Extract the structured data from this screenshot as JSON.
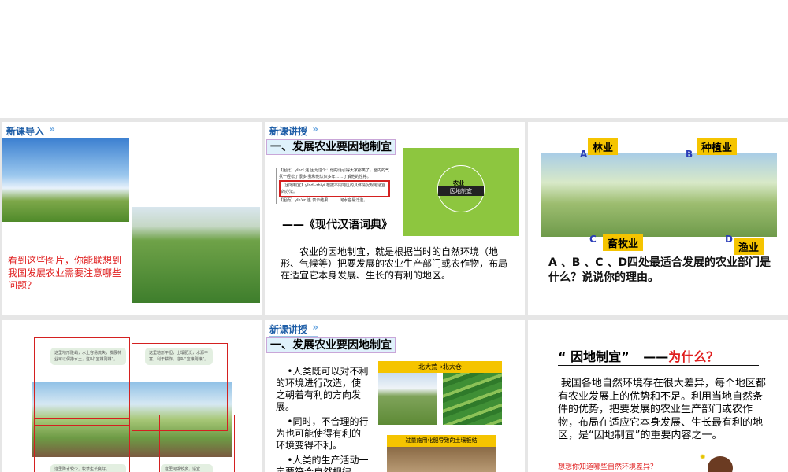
{
  "slide1": {
    "header": "新课导入",
    "question": "看到这些图片，你能联想到我国发展农业需要注意哪些问题？"
  },
  "slide2": {
    "header": "新课讲授",
    "section": "一、发展农业要因地制宜",
    "dict_entries": [
      "【因此】yīncǐ 连 因为这个：他的话引得大家都笑了，室内的气氛一经松了很多|我和他认识多年……了解他的性格。",
      "【因地制宜】yīndì-zhìyí 根据不同地区的具体情况规定适宜的办法。",
      "【因而】yīn'ér 连 表示结果：……河水容易泛滥。"
    ],
    "source": "——《现代汉语词典》",
    "diagram_center": "因地制宜",
    "diagram_top": "农业",
    "bullet": "农业的因地制宜，就是根据当时的自然环境（地形、气候等）把要发展的农业生产部门或农作物，布局在适宜它本身发展、生长的有利的地区。"
  },
  "slide3": {
    "labels": {
      "forestry": "林业",
      "planting": "种植业",
      "husbandry": "畜牧业",
      "fishery": "渔业"
    },
    "letters": {
      "a": "A",
      "b": "B",
      "c": "C",
      "d": "D"
    },
    "question": "A 、B 、C 、D四处最适合发展的农业部门是什么？说说你的理由。"
  },
  "slide4": {
    "bubbles": [
      "这里地形陡峭，水土容易流失，发展林业可以保持水土，这叫“宜林则林”。",
      "这里地形平坦，土壤肥沃，水源丰富，利于耕作，这叫“宜粮则粮”。",
      "这里降水较少，牧草生长良好，",
      "这里河湖较多，适宜"
    ]
  },
  "slide5": {
    "header": "新课讲授",
    "section": "一、发展农业要因地制宜",
    "points": [
      "•人类既可以对不利的环境进行改造，使之朝着有利的方向发展。",
      "•同时，不合理的行为也可能使得有利的环境变得不利。",
      "•人类的生产活动一定要符合自然规律，这样才可能持续"
    ],
    "photo1_caption": "北大荒→北大仓",
    "photo2_caption": "过量施用化肥导致的土壤板结"
  },
  "slide6": {
    "title_quote": "“ 因地制宜”",
    "title_dash": "——",
    "title_why": "为什么？",
    "body": "我国各地自然环境存在很大差异，每个地区都有农业发展上的优势和不足。利用当地自然条件的优势，把要发展的农业生产部门或农作物，布局在适应它本身发展、生长最有利的地区，是“因地制宜”的重要内容之一。",
    "prompt": "想想你知道哪些自然环境差异？"
  }
}
